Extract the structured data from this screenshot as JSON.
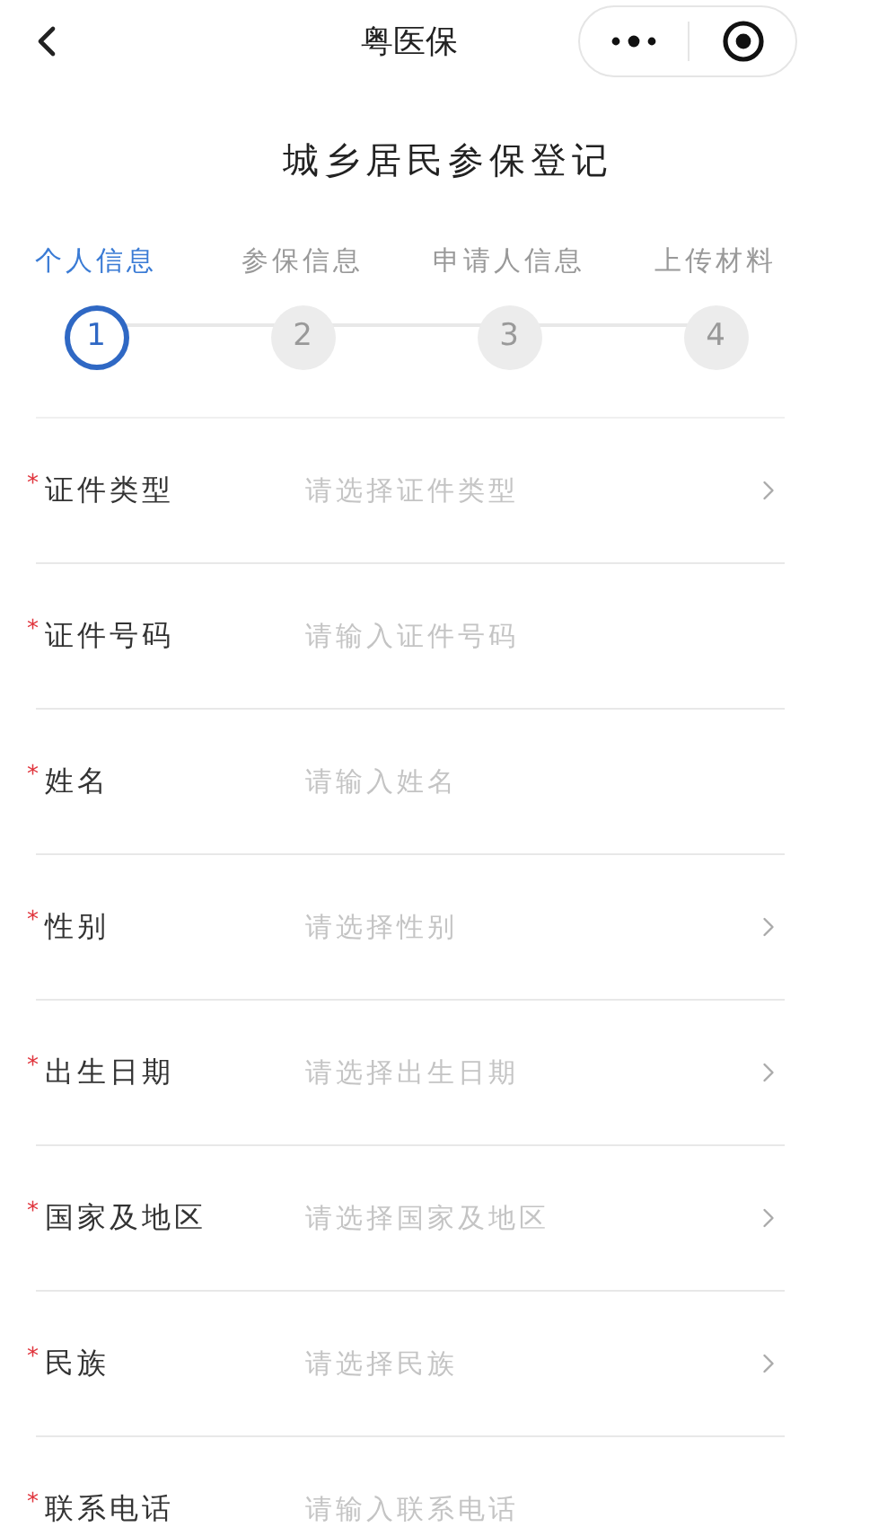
{
  "nav_bar": {
    "title": "粤医保"
  },
  "page_title": "城乡居民参保登记",
  "steps": [
    {
      "label": "个人信息",
      "number": "1",
      "selected": true
    },
    {
      "label": "参保信息",
      "number": "2",
      "selected": false
    },
    {
      "label": "申请人信息",
      "number": "3",
      "selected": false
    },
    {
      "label": "上传材料",
      "number": "4",
      "selected": false
    }
  ],
  "form_fields": [
    {
      "kind": "select",
      "required_mark": "*",
      "label": "证件类型",
      "placeholder": "请选择证件类型"
    },
    {
      "kind": "input",
      "required_mark": "*",
      "label": "证件号码",
      "placeholder": "请输入证件号码"
    },
    {
      "kind": "input",
      "required_mark": "*",
      "label": "姓名",
      "placeholder": "请输入姓名"
    },
    {
      "kind": "select",
      "required_mark": "*",
      "label": "性别",
      "placeholder": "请选择性别"
    },
    {
      "kind": "select",
      "required_mark": "*",
      "label": "出生日期",
      "placeholder": "请选择出生日期"
    },
    {
      "kind": "select",
      "required_mark": "*",
      "label": "国家及地区",
      "placeholder": "请选择国家及地区"
    },
    {
      "kind": "select",
      "required_mark": "*",
      "label": "民族",
      "placeholder": "请选择民族"
    },
    {
      "kind": "input",
      "required_mark": "*",
      "label": "联系电话",
      "placeholder": "请输入联系电话"
    }
  ]
}
